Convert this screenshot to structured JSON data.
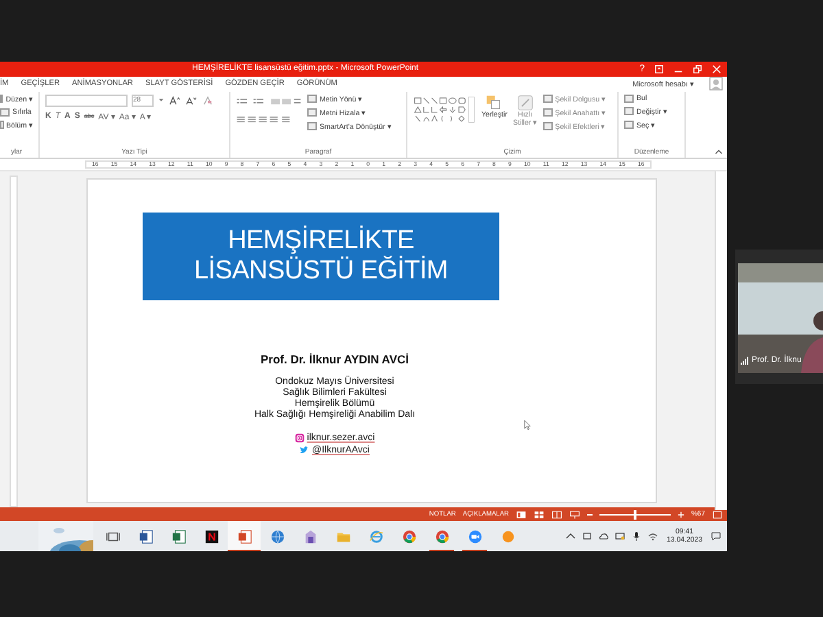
{
  "window": {
    "title": "HEMŞİRELİKTE lisansüstü eğitim.pptx - Microsoft PowerPoint",
    "help": "?"
  },
  "tabs": [
    {
      "label": "İM",
      "selected": false
    },
    {
      "label": "GEÇİŞLER",
      "selected": false
    },
    {
      "label": "ANİMASYONLAR",
      "selected": false
    },
    {
      "label": "SLAYT GÖSTERİSİ",
      "selected": false
    },
    {
      "label": "GÖZDEN GEÇİR",
      "selected": false
    },
    {
      "label": "GÖRÜNÜM",
      "selected": false
    }
  ],
  "account": "Microsoft hesabı ▾",
  "ribbon": {
    "slides": {
      "label": "ylar",
      "buttons": [
        "Düzen ▾",
        "Sıfırla",
        "Bölüm ▾"
      ]
    },
    "font": {
      "label": "Yazı Tipi",
      "size": "28",
      "tools": [
        "K",
        "T",
        "A",
        "S",
        "abc",
        "AV ▾",
        "Aa ▾",
        "A ▾"
      ]
    },
    "paragraph": {
      "label": "Paragraf",
      "buttons": [
        "Metin Yönü ▾",
        "Metni Hizala ▾",
        "SmartArt'a Dönüştür ▾"
      ]
    },
    "drawing": {
      "label": "Çizim",
      "arrange": "Yerleştir",
      "styles": [
        "Hızlı",
        "Stiller ▾"
      ],
      "buttons": [
        "Şekil Dolgusu ▾",
        "Şekil Anahattı ▾",
        "Şekil Efektleri ▾"
      ]
    },
    "editing": {
      "label": "Düzenleme",
      "buttons": [
        "Bul",
        "Değiştir ▾",
        "Seç ▾"
      ]
    }
  },
  "ruler": [
    "16",
    "15",
    "14",
    "13",
    "12",
    "11",
    "10",
    "9",
    "8",
    "7",
    "6",
    "5",
    "4",
    "3",
    "2",
    "1",
    "0",
    "1",
    "2",
    "3",
    "4",
    "5",
    "6",
    "7",
    "8",
    "9",
    "10",
    "11",
    "12",
    "13",
    "14",
    "15",
    "16"
  ],
  "slide": {
    "title": [
      "HEMŞİRELİKTE",
      "LİSANSÜSTÜ EĞİTİM"
    ],
    "author": "Prof. Dr. İlknur AYDIN AVCİ",
    "affiliation": [
      "Ondokuz Mayıs Üniversitesi",
      "Sağlık Bilimleri Fakültesi",
      "Hemşirelik Bölümü",
      "Halk Sağlığı Hemşireliği Anabilim Dalı"
    ],
    "social": [
      {
        "kind": "instagram",
        "handle": "ilknur.sezer.avci"
      },
      {
        "kind": "twitter",
        "handle": "@IlknurAAvci"
      }
    ]
  },
  "status_bar": {
    "buttons": [
      "NOTLAR",
      "AÇIKLAMALAR"
    ],
    "zoom": {
      "level": 0.5,
      "reading": "%67"
    }
  },
  "taskbar": {
    "items": [
      {
        "kind": "taskview",
        "selected": false,
        "running": false
      },
      {
        "kind": "word",
        "selected": false,
        "running": false
      },
      {
        "kind": "excel",
        "selected": false,
        "running": false
      },
      {
        "kind": "netflix",
        "selected": false,
        "running": false
      },
      {
        "kind": "powerpoint",
        "selected": true,
        "running": true
      },
      {
        "kind": "globe",
        "selected": false,
        "running": false
      },
      {
        "kind": "app",
        "selected": false,
        "running": false
      },
      {
        "kind": "folder",
        "selected": false,
        "running": false
      },
      {
        "kind": "ie",
        "selected": false,
        "running": false
      },
      {
        "kind": "chrome",
        "selected": false,
        "running": false
      },
      {
        "kind": "chrome",
        "selected": false,
        "running": true
      },
      {
        "kind": "zoom",
        "selected": false,
        "running": true
      },
      {
        "kind": "orange",
        "selected": false,
        "running": false
      }
    ],
    "time": "09:41",
    "date": "13.04.2023"
  },
  "video_tile": {
    "name": "Prof. Dr. İlknu"
  }
}
